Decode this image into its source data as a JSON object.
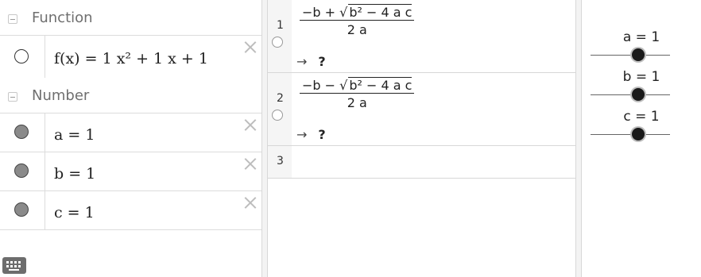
{
  "algebra": {
    "groups": [
      {
        "label": "Function"
      },
      {
        "label": "Number"
      }
    ],
    "function_item": {
      "expr": "f(x)  =  1 x² + 1 x + 1"
    },
    "number_items": [
      {
        "expr": "a = 1"
      },
      {
        "expr": "b = 1"
      },
      {
        "expr": "c = 1"
      }
    ]
  },
  "cas": {
    "rows": [
      {
        "number": "1",
        "num_prefix": "−b + ",
        "radicand": "b² − 4 a c",
        "denominator": "2 a",
        "output_arrow": "→",
        "output_value": "?"
      },
      {
        "number": "2",
        "num_prefix": "−b − ",
        "radicand": "b² − 4 a c",
        "denominator": "2 a",
        "output_arrow": "→",
        "output_value": "?"
      },
      {
        "number": "3"
      }
    ]
  },
  "graphics": {
    "sliders": [
      {
        "label": "a = 1",
        "value": 1
      },
      {
        "label": "b = 1",
        "value": 1
      },
      {
        "label": "c = 1",
        "value": 1
      }
    ]
  },
  "icons": {
    "collapse": "minus-square-icon",
    "close": "x-icon",
    "keyboard": "keyboard-icon"
  },
  "colors": {
    "marble_filled": "#8a8a8a",
    "slider_thumb": "#1a1a1a",
    "group_label": "#6f6f6f"
  }
}
